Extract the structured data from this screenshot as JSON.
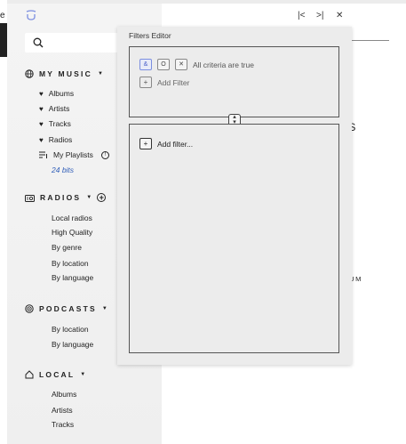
{
  "edge": {
    "text": "e C"
  },
  "window": {
    "prev_label": "|<",
    "next_label": ">|",
    "close_label": "✕"
  },
  "sidebar": {
    "my_music": {
      "title": "MY MUSIC",
      "items": [
        {
          "label": "Albums"
        },
        {
          "label": "Artists"
        },
        {
          "label": "Tracks"
        },
        {
          "label": "Radios"
        }
      ],
      "playlists_label": "My Playlists",
      "playlist_child": "24 bits"
    },
    "radios": {
      "title": "RADIOS",
      "items": [
        {
          "label": "Local radios"
        },
        {
          "label": "High Quality"
        },
        {
          "label": "By genre"
        },
        {
          "label": "By location"
        },
        {
          "label": "By language"
        }
      ]
    },
    "podcasts": {
      "title": "PODCASTS",
      "items": [
        {
          "label": "By location"
        },
        {
          "label": "By language"
        }
      ]
    },
    "local": {
      "title": "LOCAL",
      "items": [
        {
          "label": "Albums"
        },
        {
          "label": "Artists"
        },
        {
          "label": "Tracks"
        }
      ]
    }
  },
  "background": {
    "ts_text": "TS",
    "album_text": "LBUM"
  },
  "filters_editor": {
    "title": "Filters Editor",
    "criteria_buttons": [
      "&",
      "O",
      "✕"
    ],
    "criteria_text": "All criteria are true",
    "add_filter_label": "Add Filter",
    "add_filter2_label": "Add filter..."
  },
  "colors": {
    "accent": "#7b8ee0",
    "link_blue": "#2f5db8"
  }
}
